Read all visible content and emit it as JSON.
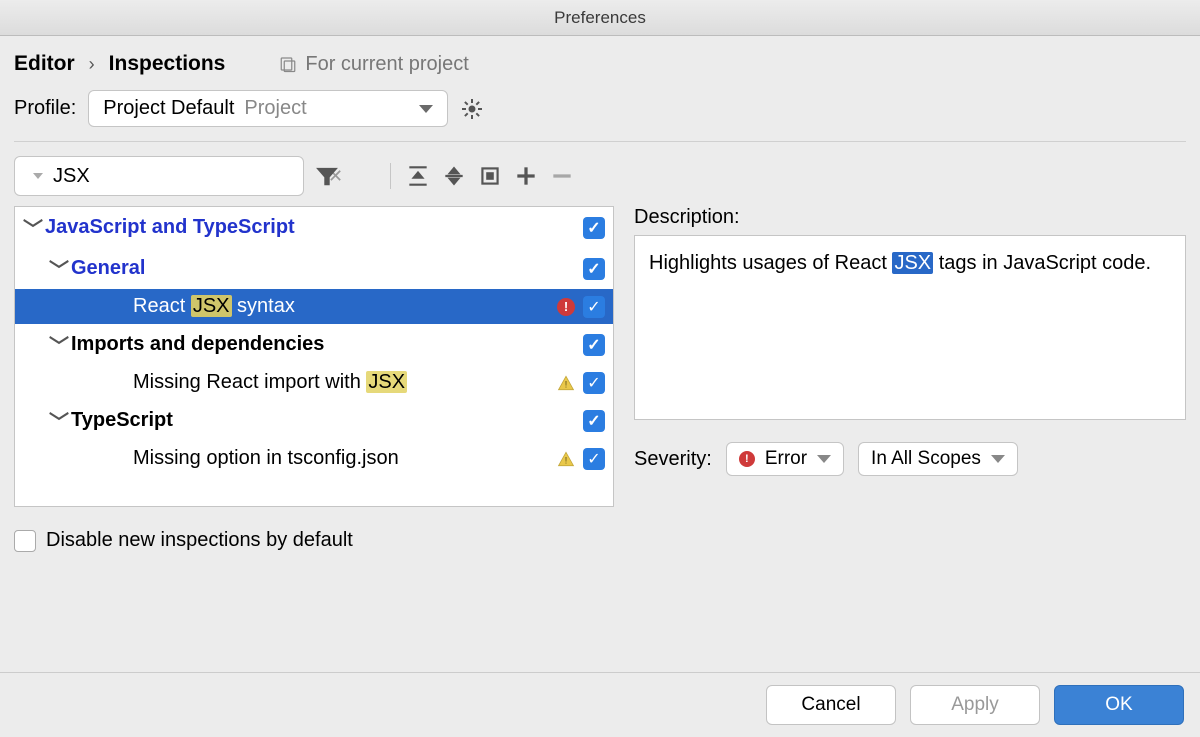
{
  "window": {
    "title": "Preferences"
  },
  "breadcrumb": {
    "editor": "Editor",
    "inspections": "Inspections"
  },
  "scope": {
    "label": "For current project"
  },
  "profile": {
    "label": "Profile:",
    "selected_name": "Project Default",
    "selected_scope": "Project"
  },
  "search": {
    "value": "JSX"
  },
  "tree": {
    "root": "JavaScript and TypeScript",
    "general": "General",
    "react_jsx_syntax_pre": "React ",
    "react_jsx_syntax_hl": "JSX",
    "react_jsx_syntax_post": " syntax",
    "imports": "Imports and dependencies",
    "missing_import_pre": "Missing React import with ",
    "missing_import_hl": "JSX",
    "typescript": "TypeScript",
    "missing_tsconfig": "Missing option in tsconfig.json"
  },
  "description": {
    "label": "Description:",
    "text_pre": "Highlights usages of React ",
    "text_hl": "JSX",
    "text_post": " tags in JavaScript code."
  },
  "severity": {
    "label": "Severity:",
    "value": "Error",
    "scope": "In All Scopes"
  },
  "disable_new": "Disable new inspections by default",
  "buttons": {
    "cancel": "Cancel",
    "apply": "Apply",
    "ok": "OK"
  }
}
